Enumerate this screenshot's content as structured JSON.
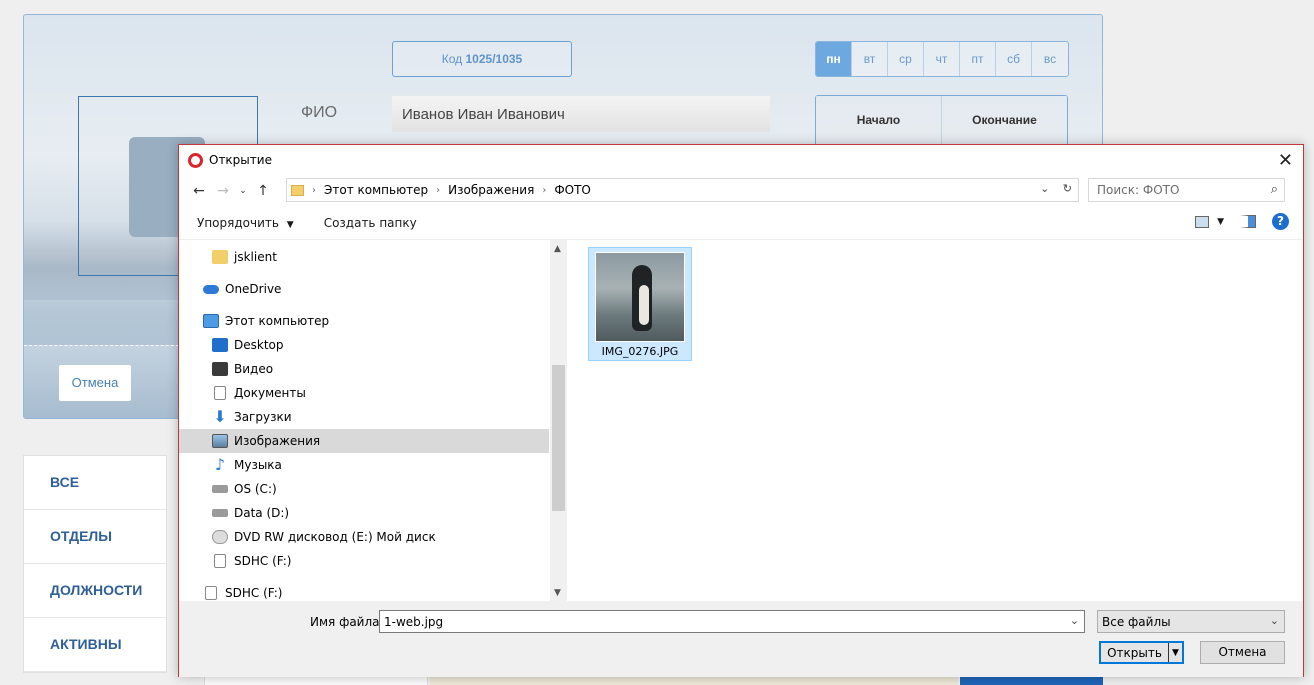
{
  "background": {
    "fio_label": "ФИО",
    "fio_value": "Иванов Иван Иванович",
    "code_label": "Код",
    "code_value": "1025/1035",
    "days": [
      "пн",
      "вт",
      "ср",
      "чт",
      "пт",
      "сб",
      "вс"
    ],
    "active_day": "пн",
    "time_start": "Начало",
    "time_end": "Окончание",
    "cancel": "Отмена",
    "side_menu": [
      "ВСЕ",
      "ОТДЕЛЫ",
      "ДОЛЖНОСТИ",
      "АКТИВНЫ"
    ]
  },
  "dialog": {
    "title": "Открытие",
    "breadcrumb": [
      "Этот компьютер",
      "Изображения",
      "ФОТО"
    ],
    "search_placeholder": "Поиск: ФОТО",
    "toolbar": {
      "organize": "Упорядочить",
      "new_folder": "Создать папку"
    },
    "tree": [
      {
        "label": "jsklient",
        "icon": "folder-icon"
      },
      {
        "label": "OneDrive",
        "icon": "cloud-icon"
      },
      {
        "label": "Этот компьютер",
        "icon": "computer-icon"
      },
      {
        "label": "Desktop",
        "icon": "desktop-icon"
      },
      {
        "label": "Видео",
        "icon": "video-icon"
      },
      {
        "label": "Документы",
        "icon": "document-icon"
      },
      {
        "label": "Загрузки",
        "icon": "download-icon"
      },
      {
        "label": "Изображения",
        "icon": "pictures-icon",
        "selected": true
      },
      {
        "label": "Музыка",
        "icon": "music-icon"
      },
      {
        "label": "OS (C:)",
        "icon": "drive-icon"
      },
      {
        "label": "Data (D:)",
        "icon": "drive-icon"
      },
      {
        "label": "DVD RW дисковод (E:) Мой диск",
        "icon": "dvd-icon"
      },
      {
        "label": "SDHC (F:)",
        "icon": "sd-icon"
      },
      {
        "label": "SDHC (F:)",
        "icon": "sd-icon"
      }
    ],
    "files": [
      {
        "name": "IMG_0276.JPG",
        "selected": true
      }
    ],
    "footer": {
      "filename_label": "Имя файла:",
      "filename_value": "1-web.jpg",
      "filter": "Все файлы",
      "open": "Открыть",
      "cancel": "Отмена"
    }
  }
}
